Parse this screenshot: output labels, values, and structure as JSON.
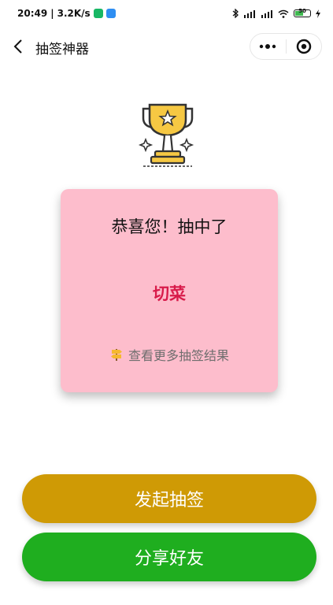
{
  "status_bar": {
    "time": "20:49",
    "net_speed": "3.2K/s",
    "battery": "50"
  },
  "nav": {
    "title": "抽签神器"
  },
  "card": {
    "congrats": "恭喜您！抽中了",
    "result": "切菜",
    "more_link": "查看更多抽签结果"
  },
  "buttons": {
    "draw": "发起抽签",
    "share": "分享好友"
  },
  "colors": {
    "card_bg": "#fdbdcc",
    "result_text": "#d81b4a",
    "draw_button": "#cf9a05",
    "share_button": "#1fae1f",
    "trophy_gold": "#f6c843"
  },
  "icons": [
    "back-arrow-icon",
    "more-dots-icon",
    "close-miniprogram-icon",
    "trophy-icon",
    "signpost-icon"
  ]
}
